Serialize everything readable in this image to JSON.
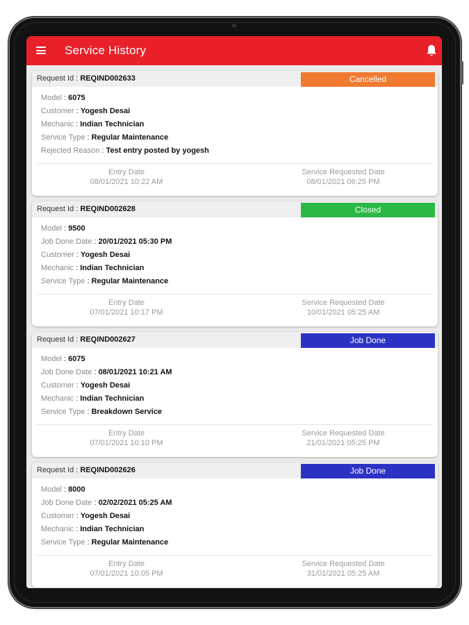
{
  "app": {
    "title": "Service History",
    "accent_color": "#e8202a",
    "menu_icon": "hamburger-menu-icon",
    "bell_icon": "bell-icon"
  },
  "labels": {
    "request_id": "Request Id : ",
    "entry_date": "Entry Date",
    "service_requested_date": "Service Requested Date"
  },
  "cards": [
    {
      "request_id": "REQIND002633",
      "status": "Cancelled",
      "status_color": "#f07a2f",
      "fields": [
        {
          "key": "Model",
          "value": "6075"
        },
        {
          "key": "Customer",
          "value": "Yogesh Desai"
        },
        {
          "key": "Mechanic",
          "value": "Indian Technician"
        },
        {
          "key": "Service Type",
          "value": "Regular Maintenance"
        },
        {
          "key": "Rejected Reason",
          "value": "Test entry posted by yogesh"
        }
      ],
      "entry_date": "08/01/2021 10:22 AM",
      "service_requested_date": "08/01/2021 06:25 PM"
    },
    {
      "request_id": "REQIND002628",
      "status": "Closed",
      "status_color": "#2bb846",
      "fields": [
        {
          "key": "Model",
          "value": "9500"
        },
        {
          "key": "Job Done Date",
          "value": "20/01/2021 05:30 PM"
        },
        {
          "key": "Customer",
          "value": "Yogesh Desai"
        },
        {
          "key": "Mechanic",
          "value": "Indian Technician"
        },
        {
          "key": "Service Type",
          "value": "Regular Maintenance"
        }
      ],
      "entry_date": "07/01/2021 10:17 PM",
      "service_requested_date": "10/01/2021 05:25 AM"
    },
    {
      "request_id": "REQIND002627",
      "status": "Job Done",
      "status_color": "#2c33c4",
      "fields": [
        {
          "key": "Model",
          "value": "6075"
        },
        {
          "key": "Job Done Date",
          "value": "08/01/2021 10:21 AM"
        },
        {
          "key": "Customer",
          "value": "Yogesh Desai"
        },
        {
          "key": "Mechanic",
          "value": "Indian Technician"
        },
        {
          "key": "Service Type",
          "value": "Breakdown Service"
        }
      ],
      "entry_date": "07/01/2021 10:10 PM",
      "service_requested_date": "21/01/2021 05:25 PM"
    },
    {
      "request_id": "REQIND002626",
      "status": "Job Done",
      "status_color": "#2c33c4",
      "fields": [
        {
          "key": "Model",
          "value": "8000"
        },
        {
          "key": "Job Done Date",
          "value": "02/02/2021 05:25 AM"
        },
        {
          "key": "Customer",
          "value": "Yogesh Desai"
        },
        {
          "key": "Mechanic",
          "value": "Indian Technician"
        },
        {
          "key": "Service Type",
          "value": "Regular Maintenance"
        }
      ],
      "entry_date": "07/01/2021 10:05 PM",
      "service_requested_date": "31/01/2021 05:25 AM"
    }
  ]
}
